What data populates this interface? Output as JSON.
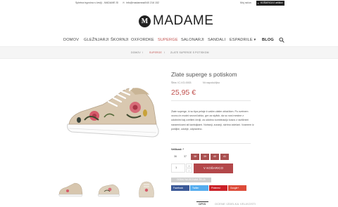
{
  "topbar": {
    "tagline": "Spletna trgovina s čevlji - MADAME.SI",
    "email": "info@madame.si",
    "phone": "040 216 152",
    "account": "Moj račun",
    "cart": "KOŠARICA 0 artiklov"
  },
  "logo": {
    "mark": "M",
    "text": "MADAME"
  },
  "nav": {
    "items": [
      "DOMOV",
      "GLEŽNJARJI",
      "ŠKORNJI",
      "OXFORDKE",
      "SUPERGE",
      "SALONARJI",
      "SANDALI",
      "ESPADRILE ▾",
      "BLOG"
    ],
    "active": "SUPERGE"
  },
  "breadcrumb": {
    "home": "DOMOV",
    "sep1": "/",
    "category": "SUPERGE",
    "sep2": "/",
    "current": "ZLATE SUPERGE S POTISKOM"
  },
  "product": {
    "title": "Zlate superge s potiskom",
    "sku": "Šifra: IC-VO-0003",
    "stock": "Ni razpoložljivo",
    "price": "25,95 €",
    "description": "Zlate superge, ki so tipa pelaje k vašim zlatim oblačilom. Po cvetnem vzorcu in modni sezoni lahko, gre za stylish, da so nosi mestne z udobnimi kaj cvetlimi čevlji, za udobno kombinacijo kosov z različnimi naramnicami ali kavbojkami. Notranji, zunanji, skrbno izdelani. Vzamem iz pošiljke, udobje, odpravimo."
  },
  "sizes": {
    "label": "Velikost: *",
    "options": [
      "36",
      "37",
      "38",
      "39",
      "40",
      "41"
    ],
    "out_of_stock": [
      "38",
      "39",
      "40",
      "41"
    ]
  },
  "quantity": {
    "value": "1",
    "plus": "+",
    "minus": "−"
  },
  "buttons": {
    "add_to_cart": "V KOŠARICO",
    "wishlist": "DODAJ NA SEZNAM ŽELJA"
  },
  "share": [
    {
      "label": "Facebook",
      "color": "#3b5998"
    },
    {
      "label": "Twitter",
      "color": "#55acee"
    },
    {
      "label": "Pinterest",
      "color": "#cb2027"
    },
    {
      "label": "Google+",
      "color": "#dd4b39"
    }
  ],
  "tabs": {
    "items": [
      "OPIS",
      "OCENE IZDELKA",
      "VELIKOSTI"
    ],
    "active": "OPIS"
  },
  "colors": {
    "accent": "#c0504d",
    "button": "#b3474a",
    "dark": "#1f1f1f"
  }
}
